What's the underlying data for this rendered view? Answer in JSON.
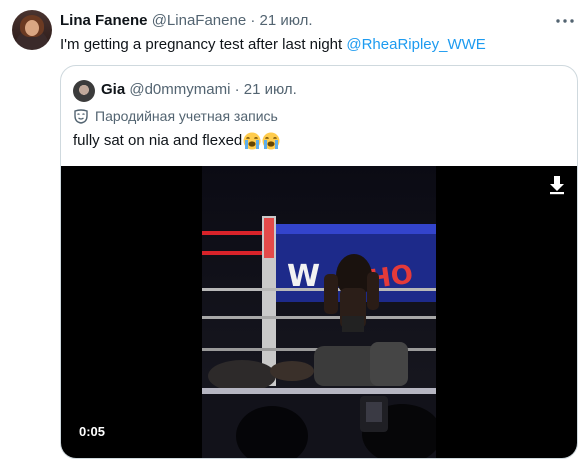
{
  "tweet": {
    "display_name": "Lina Fanene",
    "handle": "@LinaFanene",
    "separator": "·",
    "date": "21 июл.",
    "text_before": "I'm getting a pregnancy test after last night ",
    "mention": "@RheaRipley_WWE",
    "more_icon": "ellipsis-icon"
  },
  "quote": {
    "display_name": "Gia",
    "handle": "@d0mmymami",
    "separator": "·",
    "date": "21 июл.",
    "parody_label": "Пародийная учетная запись",
    "parody_icon": "mask-icon",
    "text": "fully sat on nia and flexed",
    "emojis": [
      "loudly-crying-face",
      "loudly-crying-face"
    ],
    "media": {
      "duration": "0:05",
      "download_icon": "download-arrow-icon"
    }
  },
  "colors": {
    "link": "#1d9bf0",
    "secondary_text": "#536471",
    "border": "#cfd9de"
  }
}
